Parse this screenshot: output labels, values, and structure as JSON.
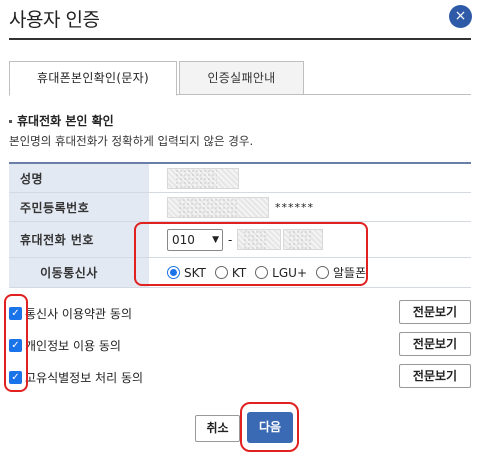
{
  "dialog": {
    "title": "사용자 인증",
    "close_icon": "×"
  },
  "tabs": [
    {
      "label": "휴대폰본인확인(문자)",
      "active": true
    },
    {
      "label": "인증실패안내",
      "active": false
    }
  ],
  "section": {
    "title": "휴대전화 본인 확인",
    "description": "본인명의 휴대전화가 정확하게 입력되지 않은 경우."
  },
  "form": {
    "name_label": "성명",
    "rrn_label": "주민등록번호",
    "rrn_back": "******",
    "phone_label": "휴대전화 번호",
    "phone_prefix": "010",
    "phone_dash": "-",
    "carrier_label": "이동통신사",
    "carriers": [
      {
        "label": "SKT",
        "checked": true
      },
      {
        "label": "KT",
        "checked": false
      },
      {
        "label": "LGU+",
        "checked": false
      },
      {
        "label": "알뜰폰",
        "checked": false
      }
    ]
  },
  "agreements": [
    {
      "label": "통신사 이용약관 동의",
      "checked": true,
      "button": "전문보기"
    },
    {
      "label": "개인정보 이용 동의",
      "checked": true,
      "button": "전문보기"
    },
    {
      "label": "고유식별정보 처리 동의",
      "checked": true,
      "button": "전문보기"
    }
  ],
  "actions": {
    "cancel": "취소",
    "next": "다음"
  },
  "colors": {
    "accent": "#3a6ab4",
    "highlight": "#e0211f",
    "header_bg": "#e3e9f3"
  }
}
